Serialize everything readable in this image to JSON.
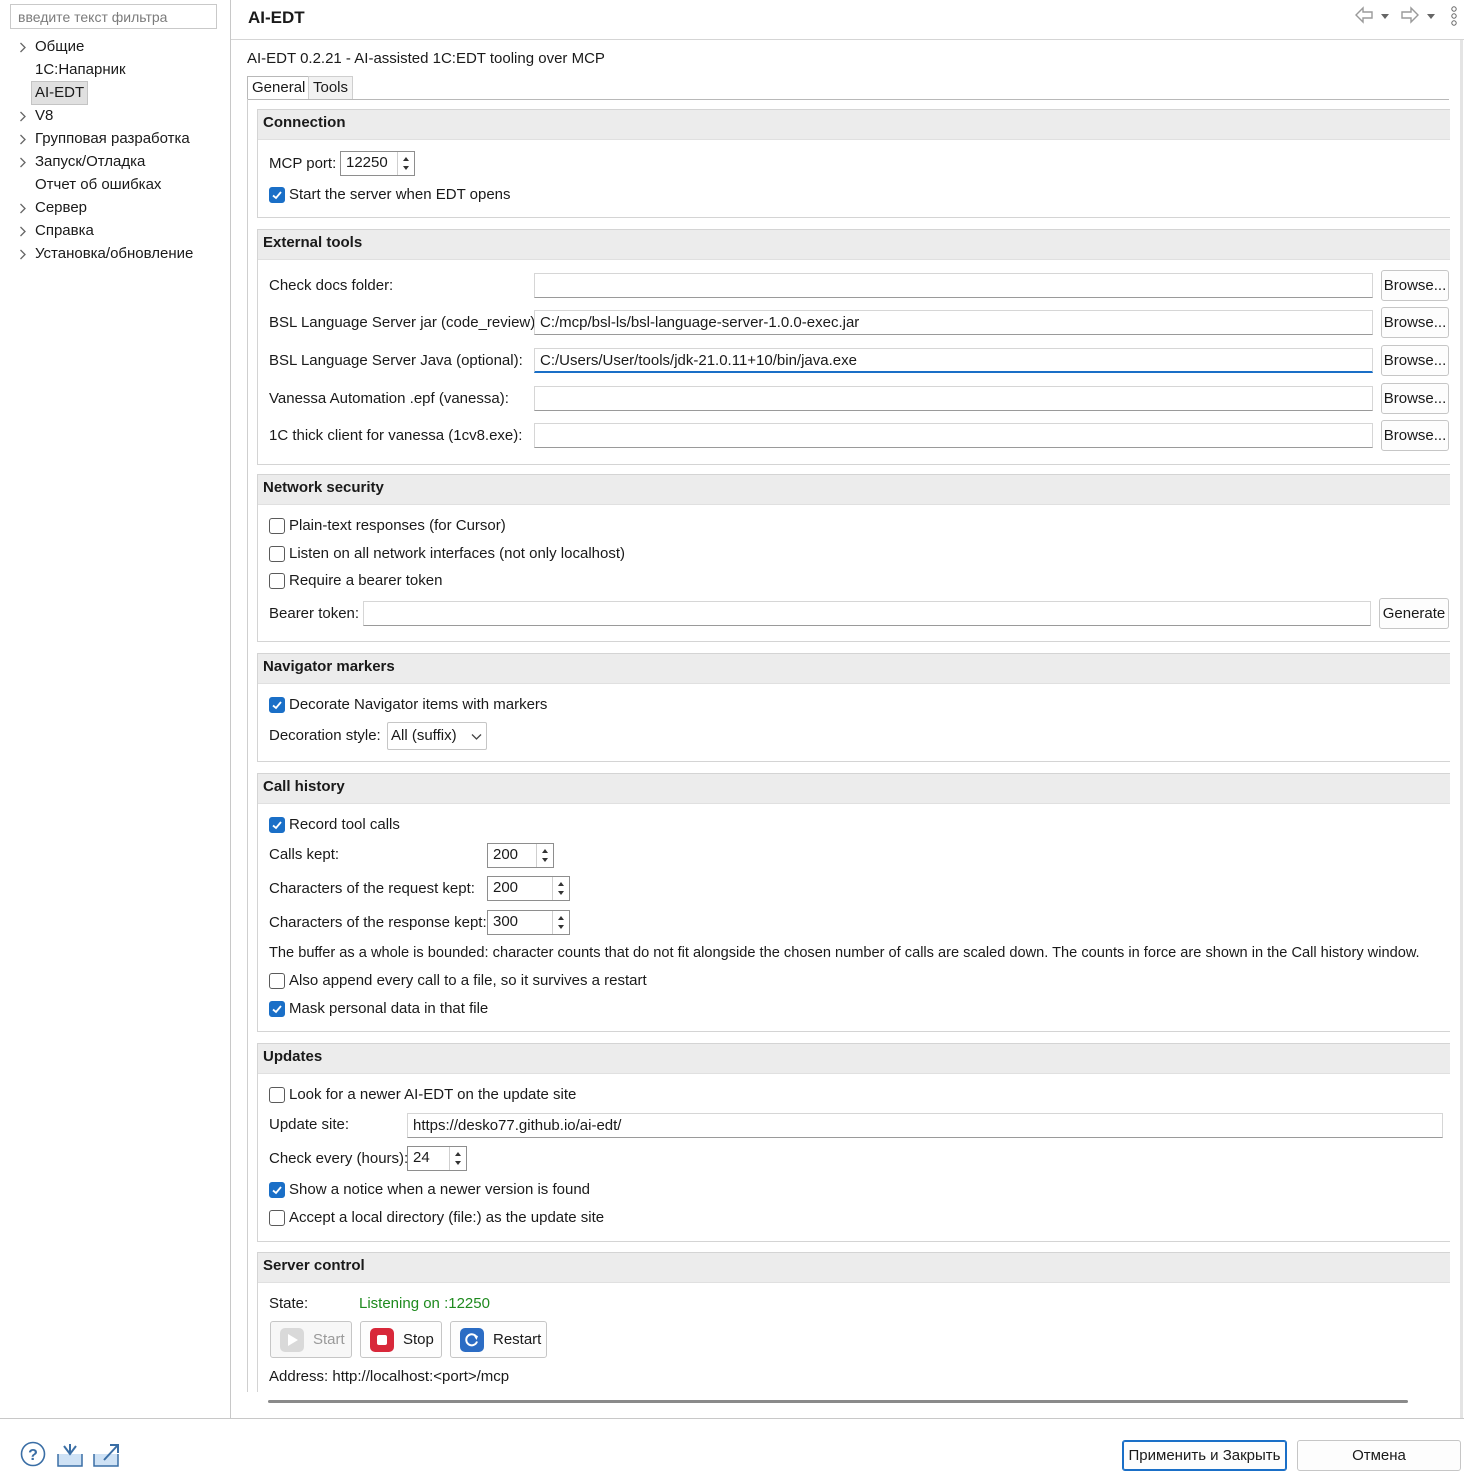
{
  "filter": {
    "placeholder": "введите текст фильтра"
  },
  "tree": [
    {
      "label": "Общие",
      "expandable": true
    },
    {
      "label": "1С:Напарник",
      "expandable": false
    },
    {
      "label": "AI-EDT",
      "expandable": false,
      "selected": true
    },
    {
      "label": "V8",
      "expandable": true
    },
    {
      "label": "Групповая разработка",
      "expandable": true
    },
    {
      "label": "Запуск/Отладка",
      "expandable": true
    },
    {
      "label": "Отчет  об ошибках",
      "expandable": false
    },
    {
      "label": "Сервер",
      "expandable": true
    },
    {
      "label": "Справка",
      "expandable": true
    },
    {
      "label": "Установка/обновление",
      "expandable": true
    }
  ],
  "header": {
    "title": "AI-EDT",
    "subtitle": "AI-EDT 0.2.21 - AI-assisted 1C:EDT tooling over MCP"
  },
  "tabs": [
    {
      "label": "General"
    },
    {
      "label": "Tools"
    }
  ],
  "connection": {
    "title": "Connection",
    "port_label": "MCP port:",
    "port_value": "12250",
    "start_label": "Start the server when EDT opens",
    "start_checked": true
  },
  "external_tools": {
    "title": "External tools",
    "browse_label": "Browse...",
    "rows": [
      {
        "label": "Check docs folder:",
        "value": ""
      },
      {
        "label": "BSL Language Server jar (code_review):",
        "value": "C:/mcp/bsl-ls/bsl-language-server-1.0.0-exec.jar"
      },
      {
        "label": "BSL Language Server Java (optional):",
        "value": "C:/Users/User/tools/jdk-21.0.11+10/bin/java.exe"
      },
      {
        "label": "Vanessa Automation .epf (vanessa):",
        "value": ""
      },
      {
        "label": "1C thick client for vanessa (1cv8.exe):",
        "value": ""
      }
    ]
  },
  "network": {
    "title": "Network  security",
    "plain_text": "Plain-text responses (for Cursor)",
    "listen_all": "Listen on all network interfaces (not only localhost)",
    "require_token": "Require a bearer token",
    "token_label": "Bearer token:",
    "token_value": "",
    "generate_label": "Generate"
  },
  "navigator": {
    "title": "Navigator markers",
    "decorate_label": "Decorate Navigator items with markers",
    "decorate_checked": true,
    "style_label": "Decoration style:",
    "style_value": "All (suffix)"
  },
  "call_history": {
    "title": "Call history",
    "record_label": "Record tool calls",
    "record_checked": true,
    "calls_kept_label": "Calls kept:",
    "calls_kept_value": "200",
    "req_label": "Characters of the request kept:",
    "req_value": "200",
    "resp_label": "Characters of the response kept:",
    "resp_value": "300",
    "note": "The buffer as a whole is bounded: character counts that do not fit alongside the chosen number of calls are scaled down. The counts in force are shown in the Call history window.",
    "append_label": "Also append every call to a file, so it survives a restart",
    "append_checked": false,
    "mask_label": "Mask personal data in that file",
    "mask_checked": true
  },
  "updates": {
    "title": "Updates",
    "look_label": "Look for a newer AI-EDT on the update site",
    "look_checked": false,
    "site_label": "Update site:",
    "site_value": "https://desko77.github.io/ai-edt/",
    "every_label": "Check every (hours):",
    "every_value": "24",
    "notice_label": "Show a notice when a newer version is found",
    "notice_checked": true,
    "local_label": "Accept a local directory (file:) as the update site",
    "local_checked": false
  },
  "server_control": {
    "title": "Server control",
    "state_label": "State:",
    "state_value": "Listening on :12250",
    "state_color": "#1e8a1e",
    "start_label": "Start",
    "stop_label": "Stop",
    "restart_label": "Restart",
    "address": "Address: http://localhost:<port>/mcp"
  },
  "footer": {
    "apply_close": "Применить и Закрыть",
    "cancel": "Отмена"
  },
  "colors": {
    "accent": "#1a6fc7",
    "stop_red": "#d8283a",
    "restart_blue": "#2b6cc4"
  }
}
